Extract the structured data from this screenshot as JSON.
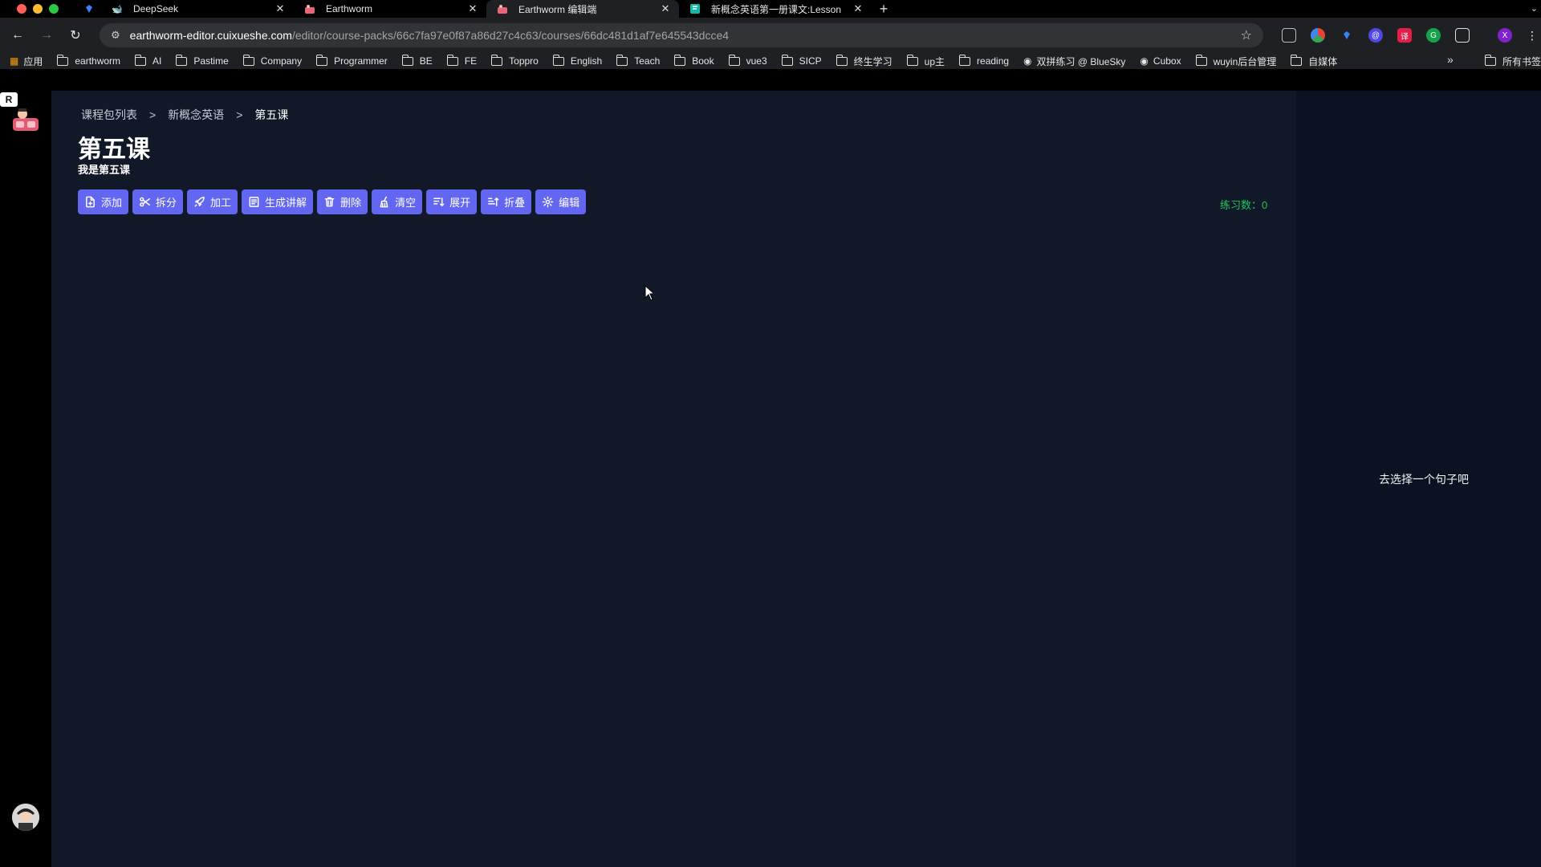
{
  "browser": {
    "tabs": [
      {
        "title": "DeepSeek",
        "icon": "deepseek-icon",
        "active": false
      },
      {
        "title": "Earthworm",
        "icon": "earthworm-icon",
        "active": false
      },
      {
        "title": "Earthworm 编辑端",
        "icon": "earthworm-icon",
        "active": true
      },
      {
        "title": "新概念英语第一册课文:Lesson",
        "icon": "doc-icon",
        "active": false
      }
    ],
    "url_host": "earthworm-editor.cuixueshe.com",
    "url_path": "/editor/course-packs/66c7fa97e0f87a86d27c4c63/courses/66dc481d1af7e645543dcce4",
    "profile_initial": "X",
    "bookmarks": [
      {
        "label": "应用",
        "type": "apps"
      },
      {
        "label": "earthworm",
        "type": "folder"
      },
      {
        "label": "AI",
        "type": "folder"
      },
      {
        "label": "Pastime",
        "type": "folder"
      },
      {
        "label": "Company",
        "type": "folder"
      },
      {
        "label": "Programmer",
        "type": "folder"
      },
      {
        "label": "BE",
        "type": "folder"
      },
      {
        "label": "FE",
        "type": "folder"
      },
      {
        "label": "Toppro",
        "type": "folder"
      },
      {
        "label": "English",
        "type": "folder"
      },
      {
        "label": "Teach",
        "type": "folder"
      },
      {
        "label": "Book",
        "type": "folder"
      },
      {
        "label": "vue3",
        "type": "folder"
      },
      {
        "label": "SICP",
        "type": "folder"
      },
      {
        "label": "终生学习",
        "type": "folder"
      },
      {
        "label": "up主",
        "type": "folder"
      },
      {
        "label": "reading",
        "type": "folder"
      },
      {
        "label": "双拼练习 @ BlueSky",
        "type": "site"
      },
      {
        "label": "Cubox",
        "type": "site"
      },
      {
        "label": "wuyin后台管理",
        "type": "folder"
      },
      {
        "label": "自媒体",
        "type": "folder"
      }
    ],
    "bookmarks_more": "»",
    "all_bookmarks": "所有书签"
  },
  "app": {
    "rail_badge": "R",
    "breadcrumb": {
      "root": "课程包列表",
      "pack": "新概念英语",
      "current": "第五课",
      "separator": ">"
    },
    "title": "第五课",
    "subtitle": "我是第五课",
    "actions": [
      "添加",
      "拆分",
      "加工",
      "生成讲解",
      "删除",
      "清空",
      "展开",
      "折叠",
      "编辑"
    ],
    "practice_count_label": "练习数：0",
    "right_panel_hint": "去选择一个句子吧",
    "colors": {
      "primary": "#6366f1",
      "success": "#22c55e",
      "main_bg": "#111827",
      "panel_bg": "#0b1222"
    }
  }
}
